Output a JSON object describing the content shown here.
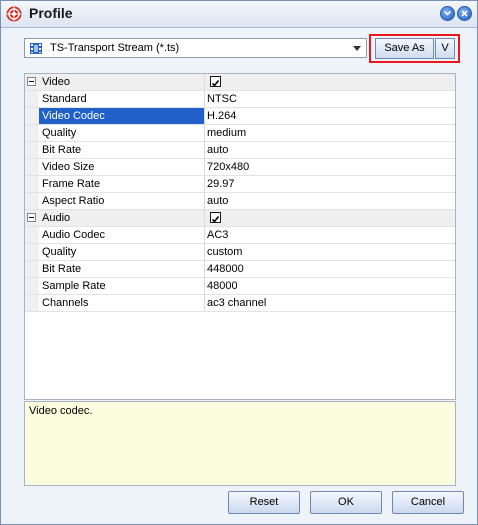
{
  "window": {
    "title": "Profile"
  },
  "format": {
    "selected": "TS-Transport Stream (*.ts)",
    "icon": "film-icon"
  },
  "toolbar": {
    "save_as_label": "Save As",
    "v_label": "V"
  },
  "properties": {
    "video": {
      "label": "Video",
      "enabled": true,
      "rows": [
        {
          "name": "Standard",
          "value": "NTSC"
        },
        {
          "name": "Video Codec",
          "value": "H.264",
          "selected": true
        },
        {
          "name": "Quality",
          "value": "medium"
        },
        {
          "name": "Bit Rate",
          "value": "auto"
        },
        {
          "name": "Video Size",
          "value": "720x480"
        },
        {
          "name": "Frame Rate",
          "value": "29.97"
        },
        {
          "name": "Aspect Ratio",
          "value": "auto"
        }
      ]
    },
    "audio": {
      "label": "Audio",
      "enabled": true,
      "rows": [
        {
          "name": "Audio Codec",
          "value": "AC3"
        },
        {
          "name": "Quality",
          "value": "custom"
        },
        {
          "name": "Bit Rate",
          "value": "448000"
        },
        {
          "name": "Sample Rate",
          "value": "48000"
        },
        {
          "name": "Channels",
          "value": "ac3 channel"
        }
      ]
    }
  },
  "description": "Video codec.",
  "buttons": {
    "reset": "Reset",
    "ok": "OK",
    "cancel": "Cancel"
  }
}
